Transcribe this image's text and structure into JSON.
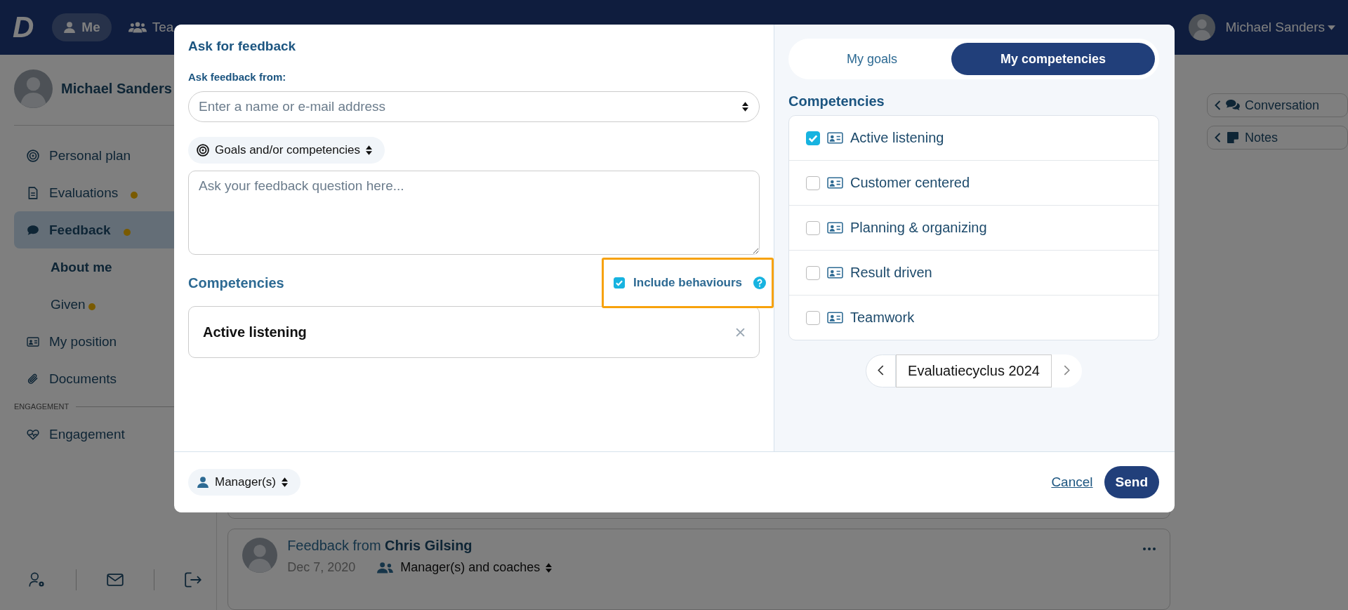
{
  "header": {
    "logo": "D",
    "nav": [
      {
        "label": "Me",
        "selected": true
      },
      {
        "label": "Tea",
        "selected": false
      }
    ],
    "user_name": "Michael Sanders"
  },
  "sidebar": {
    "profile_name": "Michael Sanders",
    "items": [
      {
        "label": "Personal plan",
        "selected": false,
        "notification": false
      },
      {
        "label": "Evaluations",
        "selected": false,
        "notification": true
      },
      {
        "label": "Feedback",
        "selected": true,
        "notification": true,
        "children": [
          {
            "label": "About me",
            "selected": true,
            "notification": false
          },
          {
            "label": "Given",
            "selected": false,
            "notification": true
          }
        ]
      },
      {
        "label": "My position",
        "selected": false,
        "notification": false
      },
      {
        "label": "Documents",
        "selected": false,
        "notification": false
      }
    ],
    "section_label": "ENGAGEMENT",
    "section_items": [
      {
        "label": "Engagement",
        "selected": false,
        "notification": false
      }
    ]
  },
  "side_buttons": [
    "Conversation",
    "Notes"
  ],
  "feedback_card": {
    "title": "Feedback from **Chris Gilsing**",
    "date": "Dec 7, 2020",
    "audience": "Manager(s) and coaches"
  },
  "modal": {
    "title": "Ask for feedback",
    "from_label": "Ask feedback from:",
    "from_field": {
      "placeholder": "Enter a name or e-mail address"
    },
    "topic_select": "Goals and/or competencies",
    "question": {
      "placeholder": "Ask your feedback question here..."
    },
    "competencies_heading": "Competencies",
    "include_behaviours": {
      "label": "Include behaviours",
      "checked": true,
      "highlighted": true
    },
    "selected_competencies": [
      "Active listening"
    ],
    "audience": "Manager(s)",
    "cancel": "Cancel",
    "send": "Send",
    "tabs": [
      {
        "label": "My goals",
        "selected": false
      },
      {
        "label": "My competencies",
        "selected": true
      }
    ],
    "list_heading": "Competencies",
    "competencies": [
      {
        "label": "Active listening",
        "checked": true
      },
      {
        "label": "Customer centered",
        "checked": false
      },
      {
        "label": "Planning & organizing",
        "checked": false
      },
      {
        "label": "Result driven",
        "checked": false
      },
      {
        "label": "Teamwork",
        "checked": false
      }
    ],
    "cycle": "Evaluatiecyclus 2024"
  }
}
